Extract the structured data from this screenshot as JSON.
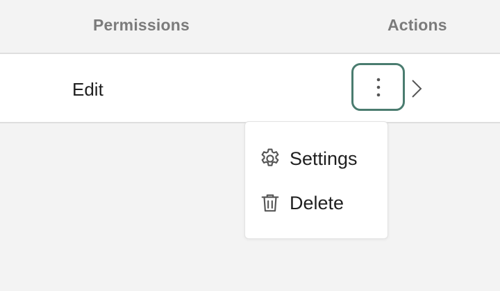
{
  "table": {
    "headers": {
      "permissions": "Permissions",
      "actions": "Actions"
    },
    "rows": [
      {
        "permission": "Edit"
      }
    ]
  },
  "actions_menu": {
    "trigger_icon": "more-vertical-icon",
    "open": true,
    "items": [
      {
        "label": "Settings",
        "icon": "gear-icon"
      },
      {
        "label": "Delete",
        "icon": "trash-icon"
      }
    ]
  },
  "colors": {
    "focus_ring": "#4a7c6f",
    "header_text": "#7b7b7b",
    "body_text": "#1f1f1f",
    "background": "#f3f3f3"
  }
}
